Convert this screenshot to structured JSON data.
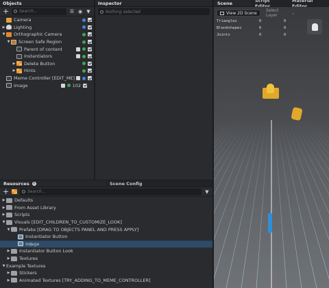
{
  "objects": {
    "title": "Objects",
    "search_placeholder": "Search...",
    "items": [
      {
        "label": "Camera"
      },
      {
        "label": "Lighting"
      },
      {
        "label": "Orthographic Camera"
      },
      {
        "label": "Screen Safe Region"
      },
      {
        "label": "Parent of content"
      },
      {
        "label": "Instantiators"
      },
      {
        "label": "Delete Button"
      },
      {
        "label": "Hints"
      },
      {
        "label": "Meme Controller [EDIT_ME]"
      },
      {
        "label": "Image",
        "count": "102"
      }
    ]
  },
  "inspector": {
    "title": "Inspector",
    "search_placeholder": "Nothing selected"
  },
  "scene_tabs": {
    "scene": "Scene",
    "script_editor": "Script Editor",
    "material_editor": "Material Editor"
  },
  "scene": {
    "view_2d_button": "View 2D Scene",
    "select_layer": "Select Layer",
    "stats": [
      {
        "key": "Triangles",
        "v1": "0",
        "v2": "0"
      },
      {
        "key": "Blendshapes",
        "v1": "0",
        "v2": "0"
      },
      {
        "key": "Joints",
        "v1": "0",
        "v2": "0"
      }
    ]
  },
  "resources": {
    "tab_resources": "Resources",
    "tab_scene_config": "Scene Config",
    "search_placeholder": "Search...",
    "items": [
      {
        "label": "Defaults"
      },
      {
        "label": "From Asset Library"
      },
      {
        "label": "Scripts"
      },
      {
        "label": "Visuals [EDIT_CHILDREN_TO_CUSTOMIZE_LOOK]"
      },
      {
        "label": "Prefabs [DRAG TO OBJECTS PANEL AND PRESS APPLY]"
      },
      {
        "label": "Instantiator Button"
      },
      {
        "label": "Image"
      },
      {
        "label": "Instantiator Button Look"
      },
      {
        "label": "Textures"
      },
      {
        "label": "Example Textures"
      },
      {
        "label": "Stickers"
      },
      {
        "label": "Animated Textures [TRY_ADDING_TO_MEME_CONTROLLER]"
      }
    ]
  },
  "colors": {
    "selection": "#2e4a68",
    "accent_blue": "#3f86d8",
    "accent_green": "#3fa552",
    "object_yellow": "#e0a92a",
    "object_blue": "#2f8fd6"
  }
}
